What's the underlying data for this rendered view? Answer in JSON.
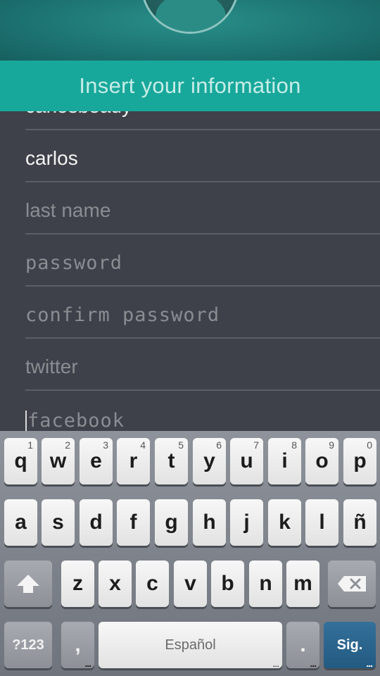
{
  "header": {
    "title": "Insert your information"
  },
  "form": {
    "partial_field_value": "carlosbeady",
    "first_name_value": "carlos",
    "last_name_placeholder": "last name",
    "password_placeholder": "password",
    "confirm_password_placeholder": "confirm password",
    "twitter_placeholder": "twitter",
    "facebook_placeholder": "facebook"
  },
  "keyboard": {
    "row1": [
      {
        "key": "q",
        "hint": "1"
      },
      {
        "key": "w",
        "hint": "2"
      },
      {
        "key": "e",
        "hint": "3"
      },
      {
        "key": "r",
        "hint": "4"
      },
      {
        "key": "t",
        "hint": "5"
      },
      {
        "key": "y",
        "hint": "6"
      },
      {
        "key": "u",
        "hint": "7"
      },
      {
        "key": "i",
        "hint": "8"
      },
      {
        "key": "o",
        "hint": "9"
      },
      {
        "key": "p",
        "hint": "0"
      }
    ],
    "row2": [
      "a",
      "s",
      "d",
      "f",
      "g",
      "h",
      "j",
      "k",
      "l",
      "ñ"
    ],
    "row3": [
      "z",
      "x",
      "c",
      "v",
      "b",
      "n",
      "m"
    ],
    "symbols_label": "?123",
    "comma_label": ",",
    "space_label": "Español",
    "period_label": ".",
    "enter_label": "Sig."
  },
  "colors": {
    "banner": "#18a89b",
    "background": "#3e4149",
    "enter_key": "#235a82"
  }
}
